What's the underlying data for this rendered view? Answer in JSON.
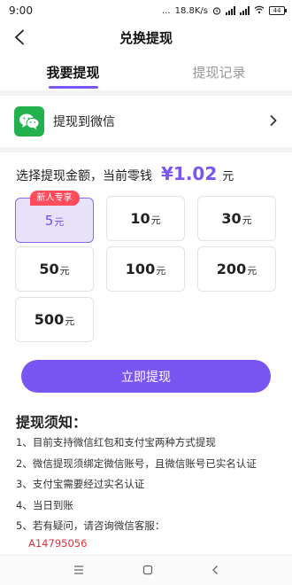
{
  "status_bar": {
    "time": "9:00",
    "network_speed": "18.8K/s",
    "dots": "...",
    "battery": "44"
  },
  "nav": {
    "title": "兑换提现",
    "back_icon": "chevron-left-icon"
  },
  "tabs": [
    {
      "label": "我要提现",
      "active": true
    },
    {
      "label": "提现记录",
      "active": false
    }
  ],
  "method": {
    "icon": "wechat-icon",
    "label": "提现到微信",
    "icon_color": "#23b14d"
  },
  "balance": {
    "prefix": "选择提现金额，当前零钱",
    "symbol": "¥",
    "amount": "1.02",
    "unit": "元"
  },
  "options": [
    {
      "value": "5",
      "unit": "元",
      "selected": true,
      "badge": "新人专享"
    },
    {
      "value": "10",
      "unit": "元",
      "selected": false
    },
    {
      "value": "30",
      "unit": "元",
      "selected": false
    },
    {
      "value": "50",
      "unit": "元",
      "selected": false
    },
    {
      "value": "100",
      "unit": "元",
      "selected": false
    },
    {
      "value": "200",
      "unit": "元",
      "selected": false
    },
    {
      "value": "500",
      "unit": "元",
      "selected": false
    }
  ],
  "submit_label": "立即提现",
  "notice": {
    "title": "提现须知：",
    "items": [
      "1、目前支持微信红包和支付宝两种方式提现",
      "2、微信提现须绑定微信账号，且微信账号已实名认证",
      "3、支付宝需要经过实名认证",
      "4、当日到账",
      "5、若有疑问，请咨询微信客服："
    ],
    "service_id": "A14795056"
  },
  "colors": {
    "accent": "#7b55f2",
    "badge": "#ff4d5e",
    "service_id": "#e2323f"
  }
}
